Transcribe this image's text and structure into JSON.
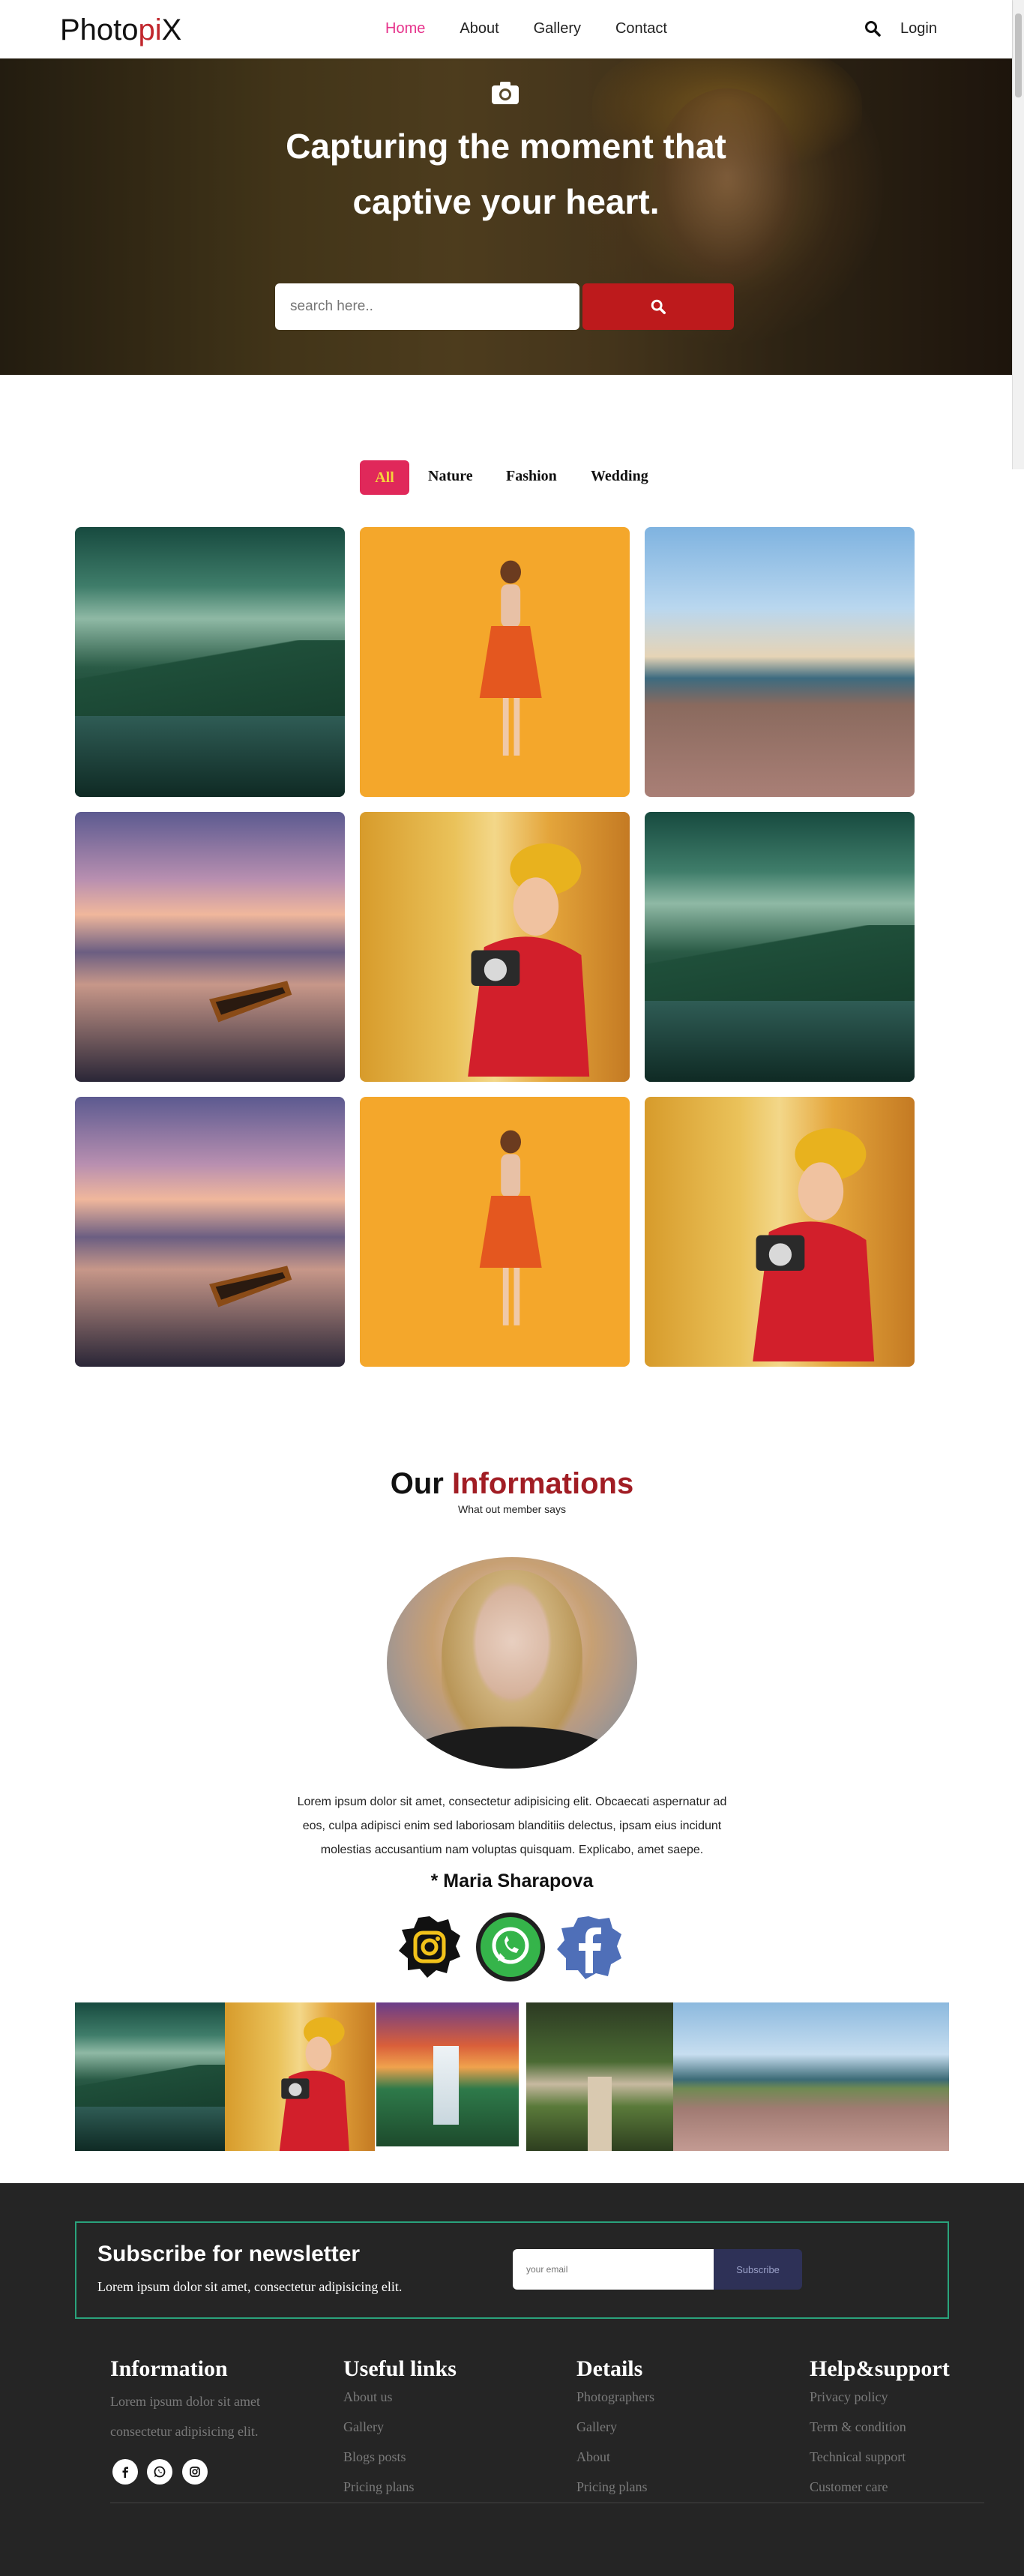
{
  "nav": {
    "brand_part1": "Photo",
    "brand_part2": "pi",
    "brand_part3": "X",
    "links": [
      "Home",
      "About",
      "Gallery",
      "Contact"
    ],
    "active_link": "Home",
    "search_icon": "search-icon",
    "login": "Login"
  },
  "hero": {
    "icon": "camera-icon",
    "title_line1": "Capturing the moment that",
    "title_line2": "captive your heart.",
    "search_placeholder": "search here..",
    "search_button_icon": "search-icon"
  },
  "filters": [
    "All",
    "Nature",
    "Fashion",
    "Wedding"
  ],
  "gallery": [
    "mountain-lake",
    "woman-orange-dress",
    "sea-deck",
    "boat-sunset",
    "woman-camera",
    "mountain-lake",
    "boat-sunset",
    "woman-orange-dress",
    "woman-camera"
  ],
  "info": {
    "title_part1": "Our",
    "title_part2": "Informations",
    "subtitle": "What out member says",
    "text": "Lorem ipsum dolor sit amet, consectetur adipisicing elit. Obcaecati aspernatur ad eos, culpa adipisci enim sed laboriosam blanditiis delectus, ipsam eius incidunt molestias accusantium nam voluptas quisquam. Explicabo, amet saepe.",
    "author": "* Maria Sharapova",
    "social": [
      "instagram-icon",
      "whatsapp-icon",
      "facebook-icon"
    ]
  },
  "strip": [
    "mountain-lake",
    "woman-camera",
    "waterfall",
    "wedding-aisle",
    "sea-deck"
  ],
  "footer": {
    "newsletter_title": "Subscribe for newsletter",
    "newsletter_text": "Lorem ipsum dolor sit amet, consectetur adipisicing elit.",
    "email_placeholder": "your email",
    "subscribe": "Subscribe",
    "columns": [
      {
        "title": "Information",
        "text": "Lorem ipsum dolor sit amet consectetur adipisicing elit."
      },
      {
        "title": "Useful links",
        "links": [
          "About us",
          "Gallery",
          "Blogs posts",
          "Pricing plans"
        ]
      },
      {
        "title": "Details",
        "links": [
          "Photographers",
          "Gallery",
          "About",
          "Pricing plans"
        ]
      },
      {
        "title": "Help&support",
        "links": [
          "Privacy policy",
          "Term & condition",
          "Technical support",
          "Customer care"
        ]
      }
    ],
    "social": [
      "facebook-icon",
      "whatsapp-icon",
      "instagram-icon"
    ]
  },
  "colors": {
    "accent_pink": "#e6338c",
    "brand_red": "#c1272d",
    "hero_button": "#bd1a1c",
    "filter_active": "#e0285a",
    "footer_bg": "#252525",
    "newsletter_border": "#2aa37c"
  }
}
